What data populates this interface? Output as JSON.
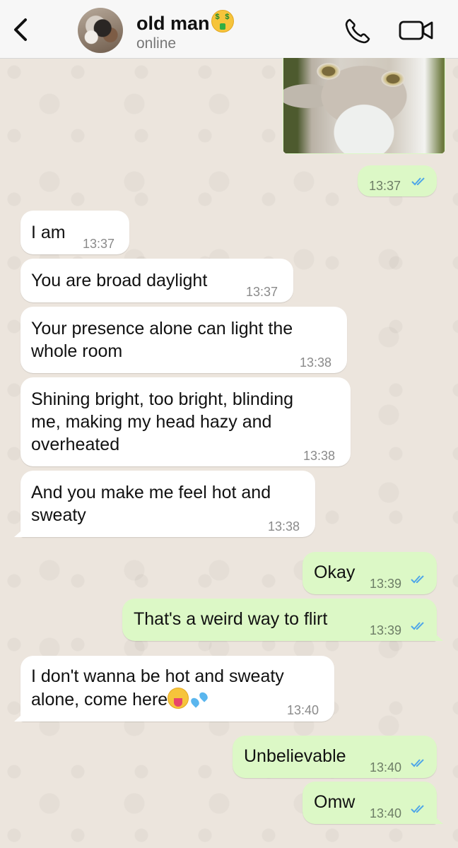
{
  "header": {
    "contact_name": "old man",
    "status": "online"
  },
  "icons": [
    "back-chevron",
    "voice-call",
    "video-call",
    "money-mouth-face",
    "double-check"
  ],
  "colors": {
    "outgoing_bubble": "#dcf8c6",
    "incoming_bubble": "#ffffff",
    "read_ticks": "#4fa6e8",
    "wallpaper": "#ece5dd"
  },
  "messages": [
    {
      "direction": "out",
      "type": "image",
      "time": "13:37",
      "status": "read"
    },
    {
      "direction": "in",
      "text": "I am",
      "time": "13:37"
    },
    {
      "direction": "in",
      "text": "You are broad daylight",
      "time": "13:37"
    },
    {
      "direction": "in",
      "lines": [
        "Your presence alone can light the",
        "whole room"
      ],
      "time": "13:38"
    },
    {
      "direction": "in",
      "lines": [
        "Shining bright, too bright, blinding",
        "me, making my head hazy and",
        "overheated"
      ],
      "time": "13:38"
    },
    {
      "direction": "in",
      "lines": [
        "And you make me feel hot and",
        "sweaty"
      ],
      "time": "13:38"
    },
    {
      "direction": "out",
      "text": "Okay",
      "time": "13:39",
      "status": "read"
    },
    {
      "direction": "out",
      "text": "That's a weird way to flirt",
      "time": "13:39",
      "status": "read"
    },
    {
      "direction": "in",
      "lines": [
        "I don't wanna be hot and sweaty",
        "alone, come here"
      ],
      "emojis": [
        "tongue",
        "sweat-droplets"
      ],
      "time": "13:40"
    },
    {
      "direction": "out",
      "text": "Unbelievable",
      "time": "13:40",
      "status": "read"
    },
    {
      "direction": "out",
      "text": "Omw",
      "time": "13:40",
      "status": "read"
    }
  ]
}
